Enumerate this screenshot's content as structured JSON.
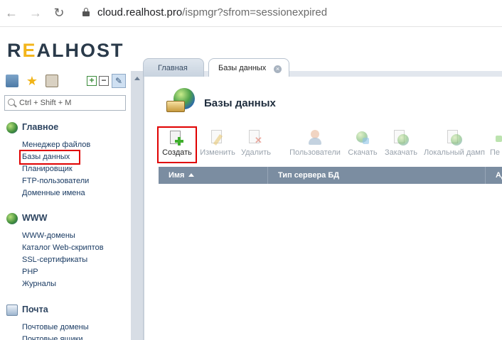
{
  "browser": {
    "url_host": "cloud.realhost.pro",
    "url_path": "/ispmgr?sfrom=sessionexpired"
  },
  "logo": {
    "text_a": "R",
    "text_e": "E",
    "text_rest": "ALHOST"
  },
  "sidebar": {
    "search_placeholder": "Ctrl + Shift + M",
    "groups": [
      {
        "title": "Главное",
        "items": [
          "Менеджер файлов",
          "Базы данных",
          "Планировщик",
          "FTP-пользователи",
          "Доменные имена"
        ]
      },
      {
        "title": "WWW",
        "items": [
          "WWW-домены",
          "Каталог Web-скриптов",
          "SSL-сертификаты",
          "PHP",
          "Журналы"
        ]
      },
      {
        "title": "Почта",
        "items": [
          "Почтовые домены",
          "Почтовые ящики"
        ]
      }
    ]
  },
  "tabs": [
    {
      "label": "Главная",
      "active": false
    },
    {
      "label": "Базы данных",
      "active": true
    }
  ],
  "page": {
    "title": "Базы данных",
    "actions": [
      {
        "label": "Создать",
        "enabled": true,
        "icon": "create-icon"
      },
      {
        "label": "Изменить",
        "enabled": false,
        "icon": "edit-icon"
      },
      {
        "label": "Удалить",
        "enabled": false,
        "icon": "delete-icon"
      },
      {
        "label": "Пользователи",
        "enabled": false,
        "icon": "users-icon"
      },
      {
        "label": "Скачать",
        "enabled": false,
        "icon": "download-icon"
      },
      {
        "label": "Закачать",
        "enabled": false,
        "icon": "upload-icon"
      },
      {
        "label": "Локальный дамп",
        "enabled": false,
        "icon": "local-dump-icon"
      },
      {
        "label": "Пе",
        "enabled": false,
        "icon": "next-icon"
      }
    ],
    "columns": [
      "Имя",
      "Тип сервера БД",
      "Ад"
    ]
  },
  "colors": {
    "highlight": "#e00000",
    "grid_header": "#7b8da1",
    "logo_accent": "#f3b51b"
  }
}
